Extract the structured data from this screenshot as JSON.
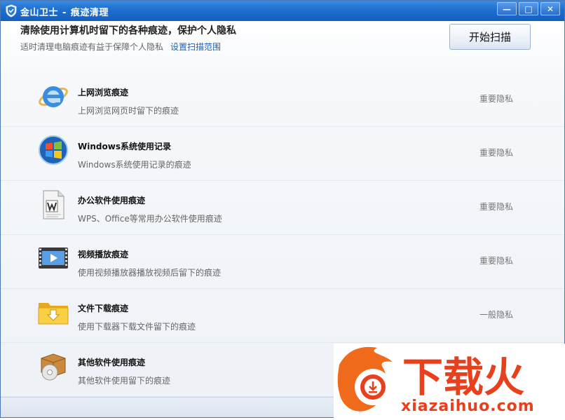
{
  "window": {
    "app_name": "金山卫士",
    "separator": "-",
    "title": "痕迹清理",
    "minimize_symbol": "—",
    "maximize_symbol": "□",
    "close_symbol": "✕"
  },
  "header": {
    "headline": "清除使用计算机时留下的各种痕迹，保护个人隐私",
    "subline": "适时清理电脑痕迹有益于保障个人隐私",
    "scan_range_link": "设置扫描范围",
    "scan_button": "开始扫描"
  },
  "items": [
    {
      "icon": "ie-browser-icon",
      "title": "上网浏览痕迹",
      "desc": "上网浏览网页时留下的痕迹",
      "level": "重要隐私"
    },
    {
      "icon": "windows-logo-icon",
      "title": "Windows系统使用记录",
      "desc": "Windows系统使用记录的痕迹",
      "level": "重要隐私"
    },
    {
      "icon": "office-document-icon",
      "title": "办公软件使用痕迹",
      "desc": "WPS、Office等常用办公软件使用痕迹",
      "level": "重要隐私"
    },
    {
      "icon": "video-film-icon",
      "title": "视频播放痕迹",
      "desc": "使用视频播放器播放视频后留下的痕迹",
      "level": "重要隐私"
    },
    {
      "icon": "download-folder-icon",
      "title": "文件下载痕迹",
      "desc": "使用下载器下载文件留下的痕迹",
      "level": "一般隐私"
    },
    {
      "icon": "software-box-icon",
      "title": "其他软件使用痕迹",
      "desc": "其他软件使用留下的痕迹",
      "level": ""
    }
  ],
  "watermark": {
    "logo_text": "下载火",
    "site": "xiazaihuo.com"
  },
  "colors": {
    "titlebar": "#1f6fd0",
    "link": "#1a5fb4",
    "watermark": "#e8401c"
  }
}
